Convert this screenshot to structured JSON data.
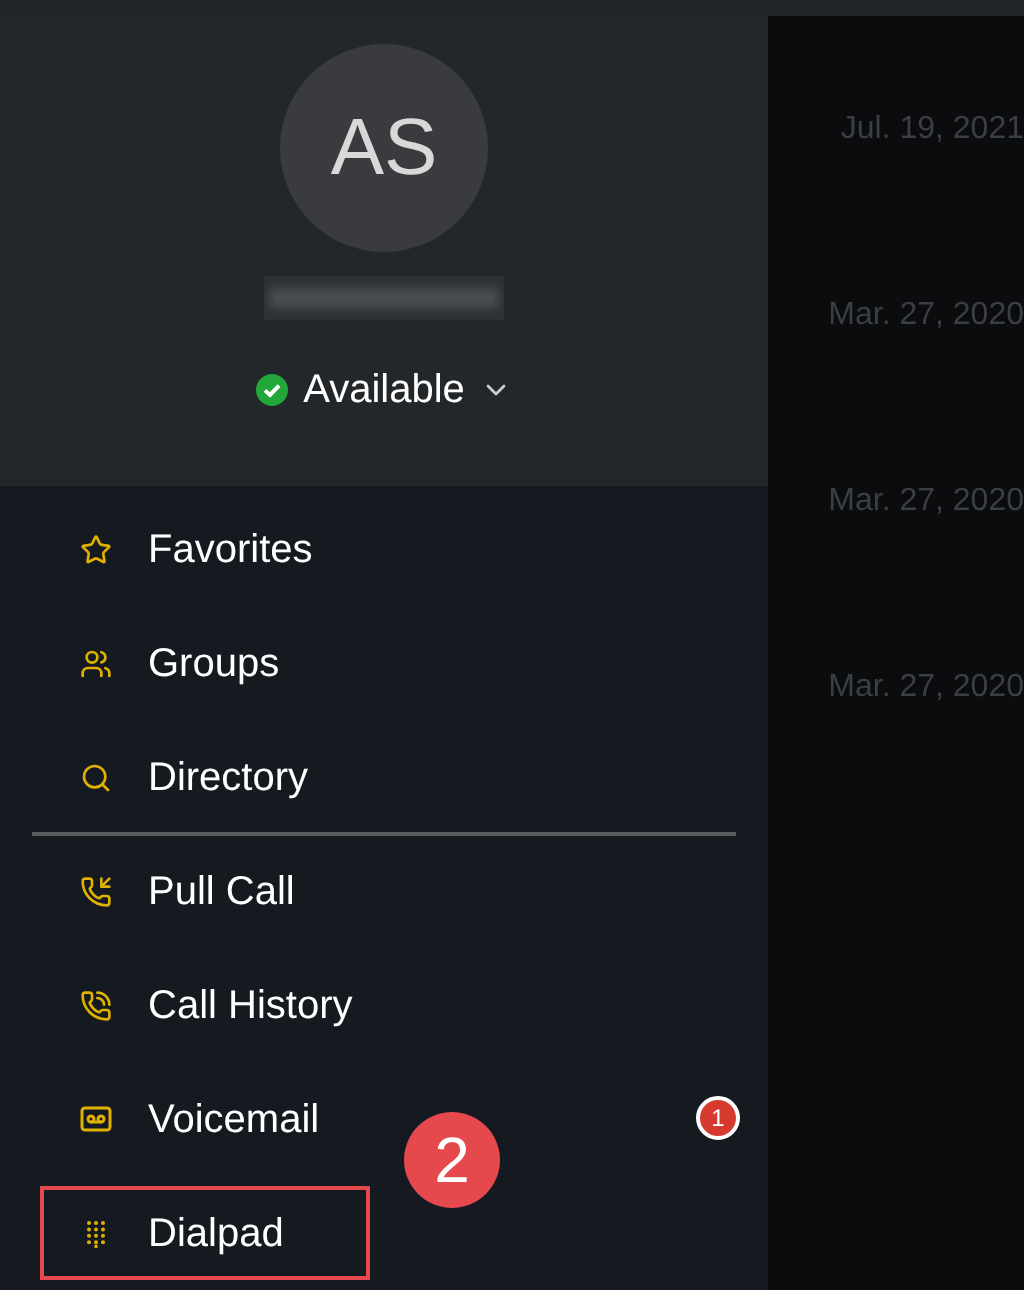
{
  "profile": {
    "initials": "AS",
    "status": "Available"
  },
  "menu": [
    {
      "label": "Favorites",
      "kind": "star",
      "highlighted": false,
      "divider_after": false
    },
    {
      "label": "Groups",
      "kind": "groups",
      "highlighted": false,
      "divider_after": false
    },
    {
      "label": "Directory",
      "kind": "search",
      "highlighted": false,
      "divider_after": true
    },
    {
      "label": "Pull Call",
      "kind": "pull",
      "highlighted": false,
      "divider_after": false
    },
    {
      "label": "Call History",
      "kind": "history",
      "highlighted": false,
      "divider_after": false
    },
    {
      "label": "Voicemail",
      "kind": "voicemail",
      "highlighted": false,
      "divider_after": false,
      "badge": "1"
    },
    {
      "label": "Dialpad",
      "kind": "dialpad",
      "highlighted": true,
      "divider_after": false
    }
  ],
  "annotation": {
    "label": "2"
  },
  "background_dates": [
    "Jul. 19, 2021",
    "Mar. 27, 2020",
    "Mar. 27, 2020",
    "Mar. 27, 2020"
  ]
}
